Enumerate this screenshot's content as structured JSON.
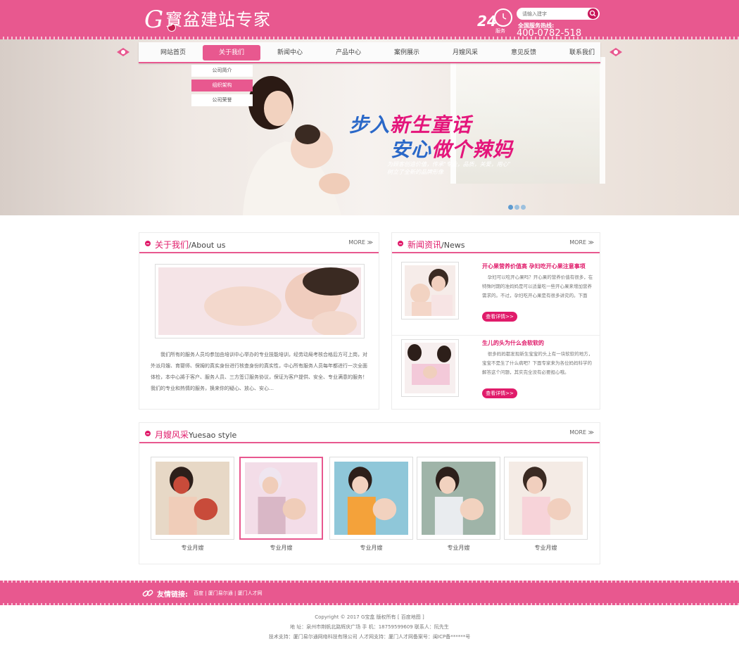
{
  "header": {
    "logo_letter": "G",
    "logo_text": "寳盆建站专家",
    "hotline_badge": "24",
    "hotline_badge_sub": "服务",
    "hotline_label": "全国服务热线:",
    "hotline_number": "400-0782-518",
    "search_placeholder": "请输入建字"
  },
  "nav": {
    "items": [
      {
        "label": "网站首页"
      },
      {
        "label": "关于我们"
      },
      {
        "label": "新闻中心"
      },
      {
        "label": "产品中心"
      },
      {
        "label": "案例展示"
      },
      {
        "label": "月嫂风采"
      },
      {
        "label": "意见反馈"
      },
      {
        "label": "联系我们"
      }
    ],
    "active_index": 1,
    "dropdown": [
      "公司简介",
      "组织架构",
      "公司荣誉"
    ],
    "dropdown_active_index": 1
  },
  "banner": {
    "title1_a": "步入",
    "title1_b": "新生童话",
    "title2_a": "安心",
    "title2_b": "做个辣妈",
    "sub1": "为顾客创造价值，传承\"专业，品质，关爱，用心\"",
    "sub2": "树立了全新的品牌形像",
    "slide_count": 3,
    "active_slide": 0
  },
  "about": {
    "title_cn": "关于我们",
    "title_en": "/About us",
    "more": "MORE",
    "text": "我们所有的服务人员均参加由培训中心举办的专业技能培训，经劳动局考核合格后方可上岗，对外派月嫂、育婴师、保姆的真实身份进行核查身份的真实性，中心所有服务人员每年都进行一次全面体检，本中心將于客户、服务人员、三方签订服务协议，保证为客户提供、安全、专业满意的服务！我们的专业和热情的服务，换来你的疑心、放心、安心…"
  },
  "news": {
    "title_cn": "新闻资讯",
    "title_en": "/News",
    "more": "MORE",
    "items": [
      {
        "title": "开心果营养价值高 孕妇吃开心果注意事项",
        "desc": "孕妇可以吃开心果吗？开心果的营养价值有很多，在特殊时期的准妈妈是可以适量吃一些开心果来增加营养需求的。不过，孕妇吃开心果是有很多讲究的。下面",
        "button": "查看详情>>"
      },
      {
        "title": "生儿的头为什么会软软的",
        "desc": "很多妈妈都发现新生宝宝的头上有一块软软的地方，宝宝不是生了什么病吧？下面专家来为各位妈妈科学的解答这个问题，其实完全没有必要担心哦。",
        "button": "查看详情>>"
      }
    ]
  },
  "yuesao": {
    "title_cn": "月嫂风采",
    "title_en": "Yuesao style",
    "more": "MORE",
    "items": [
      {
        "label": "专业月嫂"
      },
      {
        "label": "专业月嫂"
      },
      {
        "label": "专业月嫂"
      },
      {
        "label": "专业月嫂"
      },
      {
        "label": "专业月嫂"
      }
    ],
    "active_index": 1
  },
  "links": {
    "label": "友情链接:",
    "items": "百度 | 厦门易尔通 | 厦门人才网"
  },
  "footer": {
    "line1": "Copyright © 2017 G宝盒 版权所有 [ 百度地图 ]",
    "line2": "地  址：泉州市荆帆北路辉庆广场 手  机：18759599609 联系人：阮先生",
    "line3": "技术支持：厦门易尔通网络科技有限公司 人才网支持：厦门人才网备案号：闽ICP备******号"
  },
  "colors": {
    "brand_pink": "#e8588f",
    "accent_magenta": "#e01b6a",
    "banner_blue": "#2a68c8"
  }
}
